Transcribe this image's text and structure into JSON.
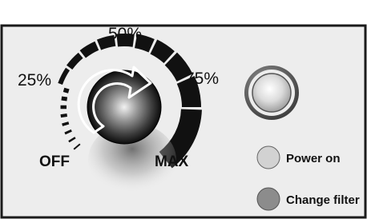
{
  "control": {
    "scale_labels": {
      "off": "OFF",
      "p25": "25%",
      "p50": "50%",
      "p75": "75%",
      "max": "MAX"
    },
    "setting": "OFF",
    "direction_hint": "clockwise"
  },
  "indicators": {
    "power_on": {
      "label": "Power on",
      "state": "off",
      "color": "#d2d2d2"
    },
    "change_filter": {
      "label": "Change filter",
      "state": "off",
      "color": "#8c8c8c"
    }
  },
  "push_button": {
    "label": ""
  },
  "colors": {
    "panel_bg": "#ededed",
    "panel_border": "#1a1a1a",
    "scale_black": "#111111",
    "arrow_stroke": "#ffffff"
  }
}
